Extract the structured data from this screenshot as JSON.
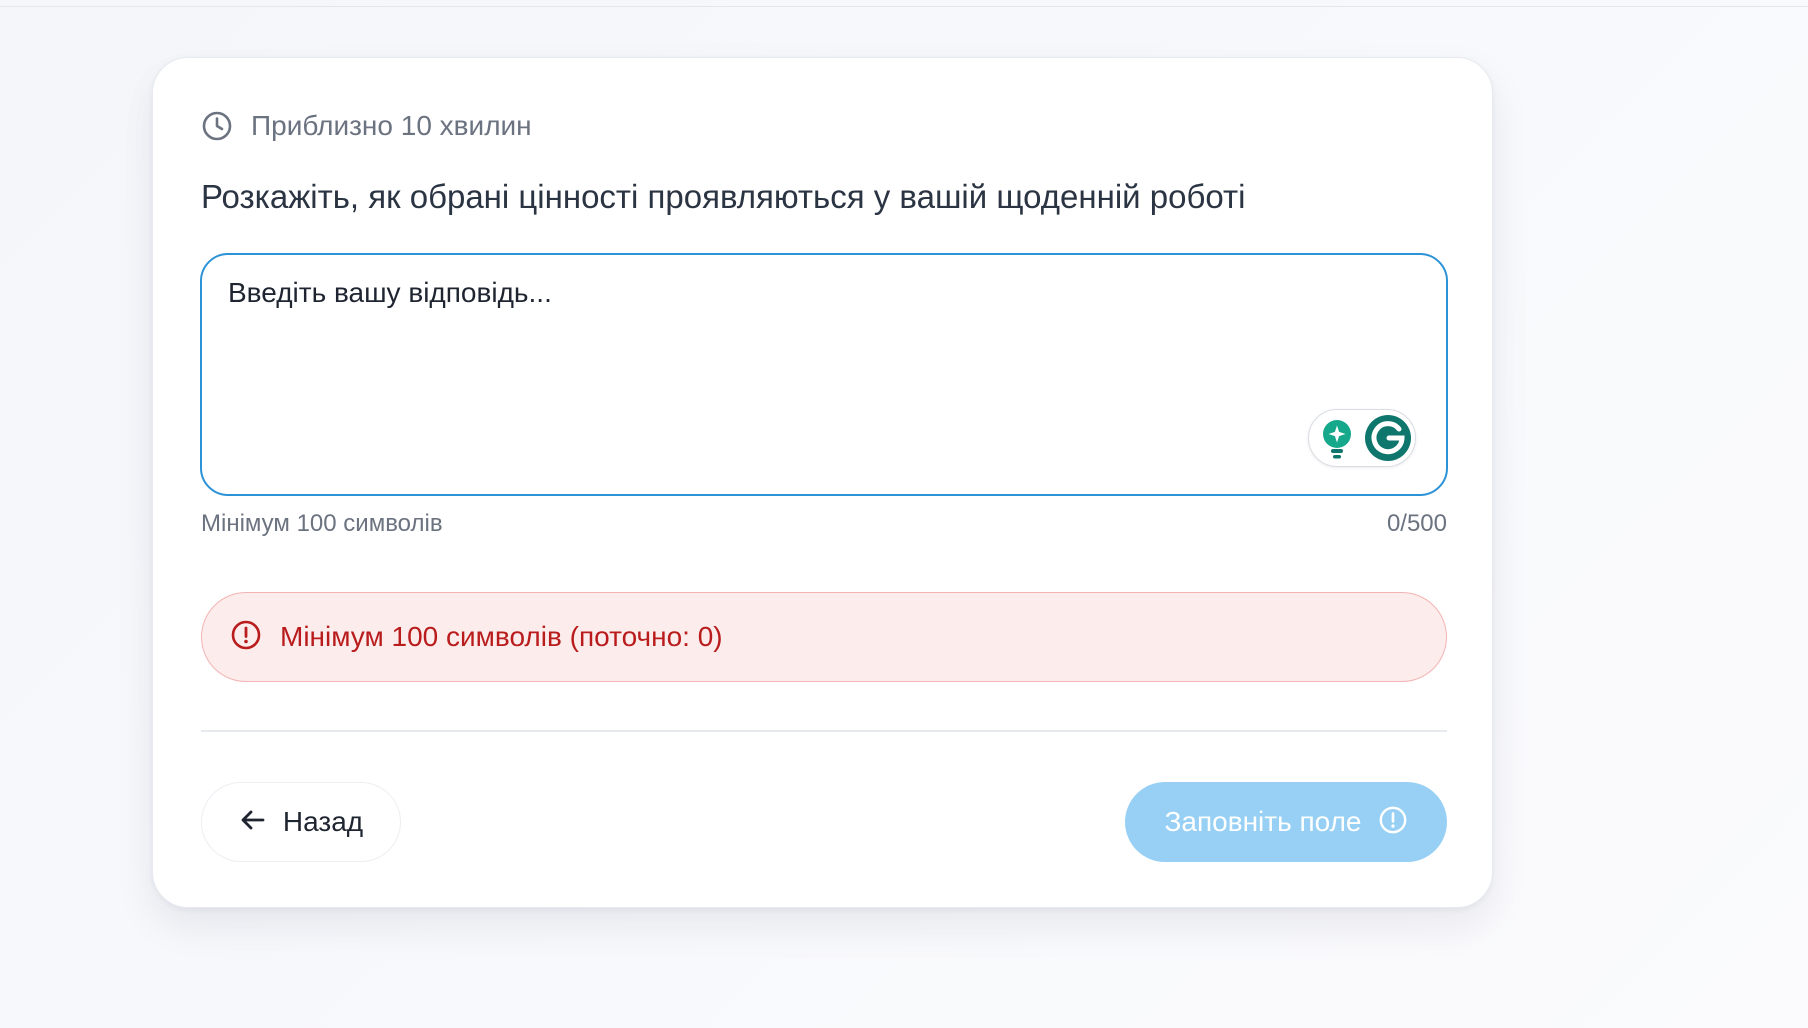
{
  "card": {
    "time_estimate": "Приблизно 10 хвилин",
    "question": "Розкажіть, як обрані цінності проявляються у вашій щоденній роботі",
    "answer": {
      "value": "",
      "placeholder": "Введіть вашу відповідь..."
    },
    "helper_text": "Мінімум 100 символів",
    "char_counter": "0/500",
    "error_message": "Мінімум 100 символів (поточно: 0)",
    "back_button_label": "Назад",
    "submit_button_label": "Заповніть поле"
  },
  "icons": {
    "time": "clock-icon",
    "error": "alert-circle-icon",
    "back": "arrow-left-icon",
    "submit": "alert-circle-icon",
    "grammarly_suggestions": "lightbulb-icon",
    "grammarly": "grammarly-logo-icon"
  },
  "colors": {
    "accent_border": "#2b93d6",
    "error_text": "#b91c1c",
    "error_background": "#fdecec",
    "submit_disabled": "#97d0f4",
    "grammarly_green": "#15a88a",
    "grammarly_dark": "#0f766e"
  }
}
